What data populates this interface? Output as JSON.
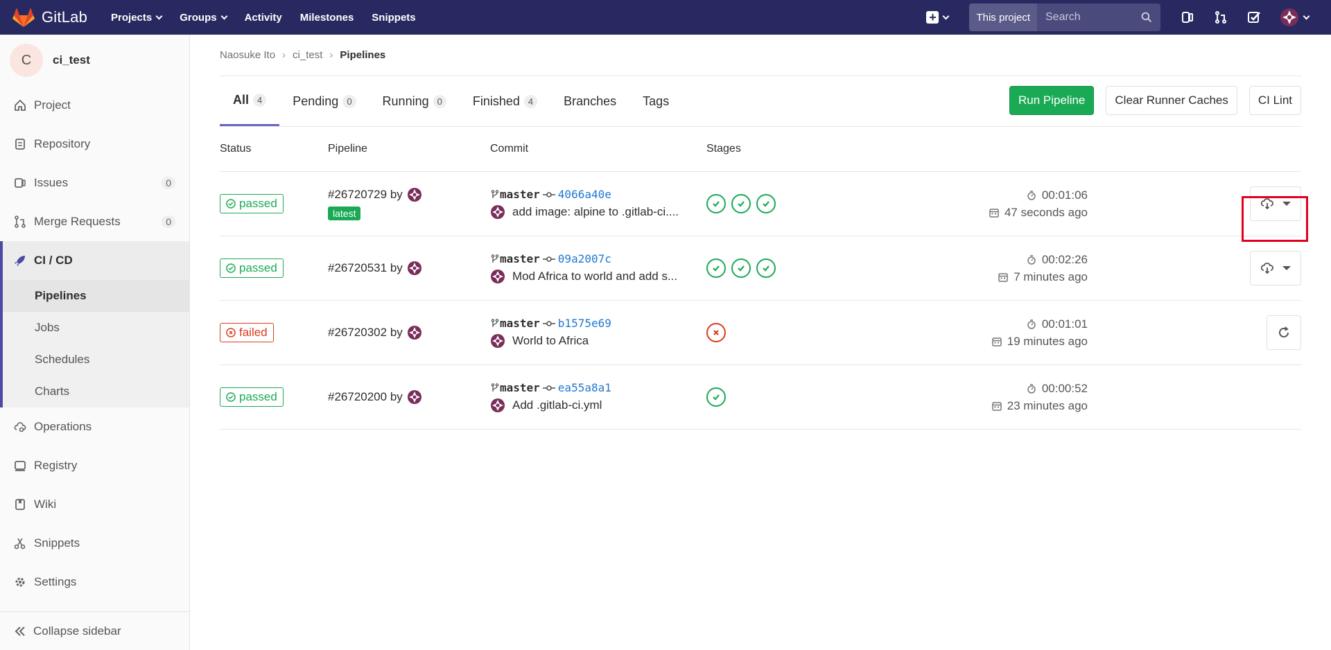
{
  "app": {
    "name": "GitLab"
  },
  "topnav": {
    "links": [
      "Projects",
      "Groups",
      "Activity",
      "Milestones",
      "Snippets"
    ],
    "search_scope": "This project",
    "search_placeholder": "Search"
  },
  "sidebar": {
    "project_initial": "C",
    "project_name": "ci_test",
    "items": [
      {
        "label": "Project",
        "icon": "home-icon"
      },
      {
        "label": "Repository",
        "icon": "doc-icon"
      },
      {
        "label": "Issues",
        "icon": "issues-icon",
        "count": "0"
      },
      {
        "label": "Merge Requests",
        "icon": "merge-icon",
        "count": "0"
      }
    ],
    "active": {
      "label": "CI / CD",
      "icon": "rocket-icon"
    },
    "sub_items": [
      "Pipelines",
      "Jobs",
      "Schedules",
      "Charts"
    ],
    "lower_items": [
      {
        "label": "Operations",
        "icon": "cloud-gear-icon"
      },
      {
        "label": "Registry",
        "icon": "disk-icon"
      },
      {
        "label": "Wiki",
        "icon": "book-icon"
      },
      {
        "label": "Snippets",
        "icon": "scissors-icon"
      },
      {
        "label": "Settings",
        "icon": "gear-icon"
      }
    ],
    "collapse_label": "Collapse sidebar"
  },
  "breadcrumb": [
    "Naosuke Ito",
    "ci_test",
    "Pipelines"
  ],
  "tabs": [
    {
      "label": "All",
      "count": "4"
    },
    {
      "label": "Pending",
      "count": "0"
    },
    {
      "label": "Running",
      "count": "0"
    },
    {
      "label": "Finished",
      "count": "4"
    },
    {
      "label": "Branches"
    },
    {
      "label": "Tags"
    }
  ],
  "actions": {
    "run": "Run Pipeline",
    "clear": "Clear Runner Caches",
    "lint": "CI Lint"
  },
  "table": {
    "headers": [
      "Status",
      "Pipeline",
      "Commit",
      "Stages"
    ],
    "rows": [
      {
        "status": "passed",
        "id": "#26720729",
        "by": "by",
        "badge": "latest",
        "branch": "master",
        "sha": "4066a40e",
        "message": "add image: alpine to .gitlab-ci....",
        "stages": [
          "success",
          "success",
          "success"
        ],
        "duration": "00:01:06",
        "ago": "47 seconds ago",
        "action": "download"
      },
      {
        "status": "passed",
        "id": "#26720531",
        "by": "by",
        "branch": "master",
        "sha": "09a2007c",
        "message": "Mod Africa to world and add s...",
        "stages": [
          "success",
          "success",
          "success"
        ],
        "duration": "00:02:26",
        "ago": "7 minutes ago",
        "action": "download"
      },
      {
        "status": "failed",
        "id": "#26720302",
        "by": "by",
        "branch": "master",
        "sha": "b1575e69",
        "message": "World to Africa",
        "stages": [
          "failed"
        ],
        "duration": "00:01:01",
        "ago": "19 minutes ago",
        "action": "retry"
      },
      {
        "status": "passed",
        "id": "#26720200",
        "by": "by",
        "branch": "master",
        "sha": "ea55a8a1",
        "message": "Add .gitlab-ci.yml",
        "stages": [
          "success"
        ],
        "duration": "00:00:52",
        "ago": "23 minutes ago",
        "action": "none"
      }
    ]
  },
  "colors": {
    "nav": "#292961",
    "success": "#1aaa55",
    "failed": "#db3b21",
    "link": "#1f78d1",
    "highlight": "#e3001b"
  }
}
